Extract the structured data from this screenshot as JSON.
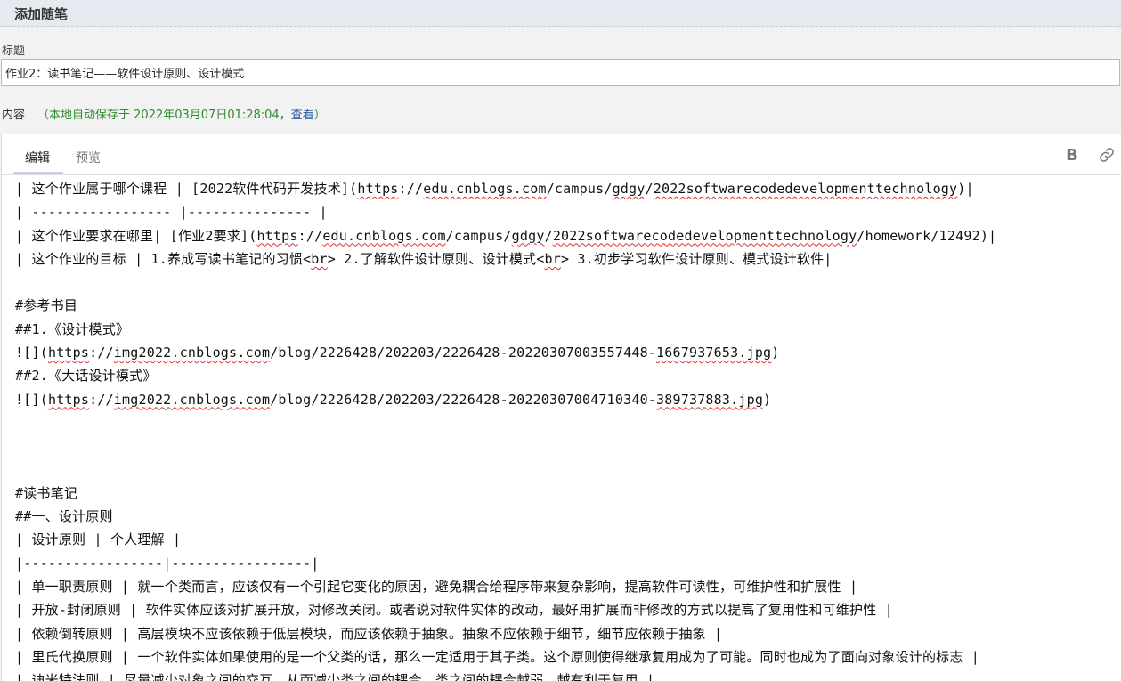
{
  "header": {
    "title": "添加随笔"
  },
  "form": {
    "title_label": "标题",
    "title_value": "作业2：读书笔记——软件设计原则、设计模式",
    "content_label": "内容",
    "autosave_prefix": "（本地自动保存于 2022年03月07日01:28:04，",
    "autosave_link": "查看",
    "autosave_suffix": "）"
  },
  "editor": {
    "tabs": [
      {
        "label": "编辑",
        "active": true
      },
      {
        "label": "预览",
        "active": false
      }
    ],
    "toolbar": {
      "bold_label": "B",
      "bold_icon": "bold-icon",
      "link_icon": "link-icon"
    },
    "lines": [
      [
        {
          "t": "| 这个作业属于哪个课程 | [2022软件代码开发技术]("
        },
        {
          "t": "https",
          "s": 1
        },
        {
          "t": "://"
        },
        {
          "t": "edu.cnblogs.com",
          "s": 1
        },
        {
          "t": "/campus/"
        },
        {
          "t": "gdgy",
          "s": 1
        },
        {
          "t": "/"
        },
        {
          "t": "2022softwarecodedevelopmenttechnology",
          "s": 1
        },
        {
          "t": ")|"
        }
      ],
      [
        {
          "t": "| ----------------- |--------------- |"
        }
      ],
      [
        {
          "t": "| 这个作业要求在哪里| [作业2要求]("
        },
        {
          "t": "https",
          "s": 1
        },
        {
          "t": "://"
        },
        {
          "t": "edu.cnblogs.com",
          "s": 1
        },
        {
          "t": "/campus/"
        },
        {
          "t": "gdgy",
          "s": 1
        },
        {
          "t": "/"
        },
        {
          "t": "2022softwarecodedevelopmenttechnology",
          "s": 1
        },
        {
          "t": "/homework/12492)|"
        }
      ],
      [
        {
          "t": "| 这个作业的目标 | 1.养成写读书笔记的习惯<"
        },
        {
          "t": "br",
          "s": 1
        },
        {
          "t": "> 2.了解软件设计原则、设计模式<"
        },
        {
          "t": "br",
          "s": 1
        },
        {
          "t": "> 3.初步学习软件设计原则、模式设计软件|"
        }
      ],
      [
        {
          "t": ""
        }
      ],
      [
        {
          "t": "#参考书目"
        }
      ],
      [
        {
          "t": "##1.《设计模式》"
        }
      ],
      [
        {
          "t": "![]("
        },
        {
          "t": "https",
          "s": 1
        },
        {
          "t": "://"
        },
        {
          "t": "img2022.cnblogs.com",
          "s": 1
        },
        {
          "t": "/blog/2226428/202203/2226428-20220307003557448-"
        },
        {
          "t": "1667937653.jpg",
          "s": 1
        },
        {
          "t": ")"
        }
      ],
      [
        {
          "t": "##2.《大话设计模式》"
        }
      ],
      [
        {
          "t": "![]("
        },
        {
          "t": "https",
          "s": 1
        },
        {
          "t": "://"
        },
        {
          "t": "img2022.cnblogs.com",
          "s": 1
        },
        {
          "t": "/blog/2226428/202203/2226428-20220307004710340-"
        },
        {
          "t": "389737883.jpg",
          "s": 1
        },
        {
          "t": ")"
        }
      ],
      [
        {
          "t": ""
        }
      ],
      [
        {
          "t": ""
        }
      ],
      [
        {
          "t": ""
        }
      ],
      [
        {
          "t": "#读书笔记"
        }
      ],
      [
        {
          "t": "##一、设计原则"
        }
      ],
      [
        {
          "t": "| 设计原则 | 个人理解 |"
        }
      ],
      [
        {
          "t": "|-----------------|-----------------|"
        }
      ],
      [
        {
          "t": "| 单一职责原则 | 就一个类而言，应该仅有一个引起它变化的原因，避免耦合给程序带来复杂影响，提高软件可读性，可维护性和扩展性 |"
        }
      ],
      [
        {
          "t": "| 开放-封闭原则 | 软件实体应该对扩展开放，对修改关闭。或者说对软件实体的改动，最好用扩展而非修改的方式以提高了复用性和可维护性 |"
        }
      ],
      [
        {
          "t": "| 依赖倒转原则 | 高层模块不应该依赖于低层模块，而应该依赖于抽象。抽象不应依赖于细节，细节应依赖于抽象 |"
        }
      ],
      [
        {
          "t": "| 里氏代换原则 | 一个软件实体如果使用的是一个父类的话，那么一定适用于其子类。这个原则使得继承复用成为了可能。同时也成为了面向对象设计的标志 |"
        }
      ],
      [
        {
          "t": "| 迪米特法则 | 尽量减少对象之间的交互，从而减少类之间的耦合，类之间的耦合越弱，越有利于复用 |"
        }
      ]
    ]
  }
}
